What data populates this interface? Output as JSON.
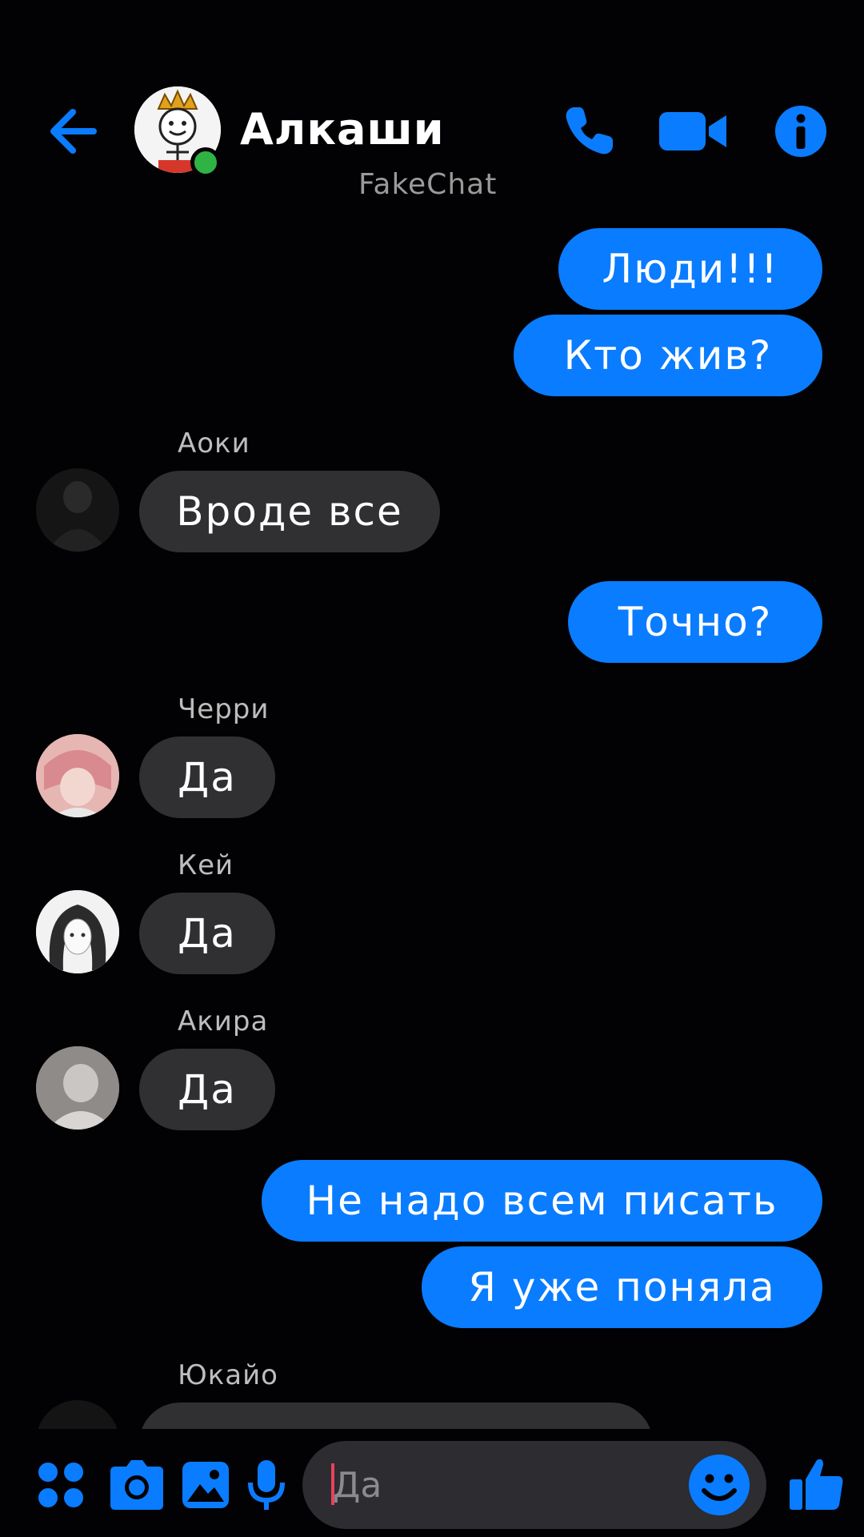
{
  "header": {
    "title": "Алкаши",
    "watermark": "FakeChat",
    "back_icon": "arrow-left-icon",
    "call_icon": "phone-icon",
    "video_icon": "video-camera-icon",
    "info_icon": "info-icon"
  },
  "messages": [
    {
      "dir": "out",
      "text": "Люди!!!"
    },
    {
      "dir": "out",
      "text": "Кто жив?"
    },
    {
      "dir": "in",
      "sender": "Аоки",
      "text": "Вроде все"
    },
    {
      "dir": "out",
      "text": "Точно?"
    },
    {
      "dir": "in",
      "sender": "Черри",
      "text": "Да"
    },
    {
      "dir": "in",
      "sender": "Кей",
      "text": "Да"
    },
    {
      "dir": "in",
      "sender": "Акира",
      "text": "Да"
    },
    {
      "dir": "out",
      "text": "Не надо всем писать"
    },
    {
      "dir": "out",
      "text": "Я уже поняла"
    },
    {
      "dir": "in",
      "sender": "Юкайо",
      "text": ""
    }
  ],
  "composer": {
    "input_value": "Да",
    "icons": [
      "apps-icon",
      "camera-icon",
      "image-icon",
      "microphone-icon",
      "emoji-icon",
      "thumbs-up-icon"
    ]
  },
  "colors": {
    "accent": "#0a7cff",
    "incoming_bubble": "#303033",
    "background": "#020204",
    "online": "#2fb344"
  }
}
